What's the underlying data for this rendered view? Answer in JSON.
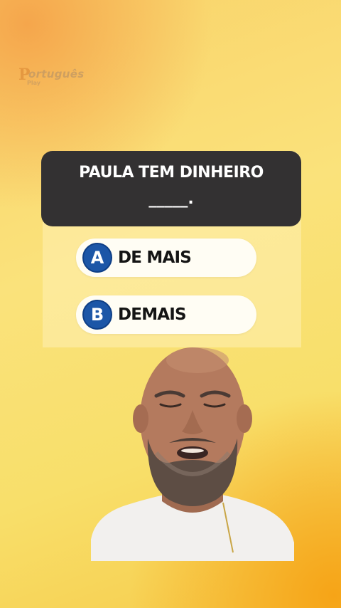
{
  "logo": {
    "letter": "P",
    "word": "ortuguês",
    "sub": "Play"
  },
  "question": {
    "line1": "PAULA TEM DINHEIRO",
    "line2": "_____."
  },
  "options": [
    {
      "letter": "A",
      "text": "DE MAIS"
    },
    {
      "letter": "B",
      "text": "DEMAIS"
    }
  ],
  "colors": {
    "question_bg": "#333132",
    "option_bg": "#fffdf4",
    "letter_circle": "#1c56a7",
    "background": "#fae27b"
  }
}
